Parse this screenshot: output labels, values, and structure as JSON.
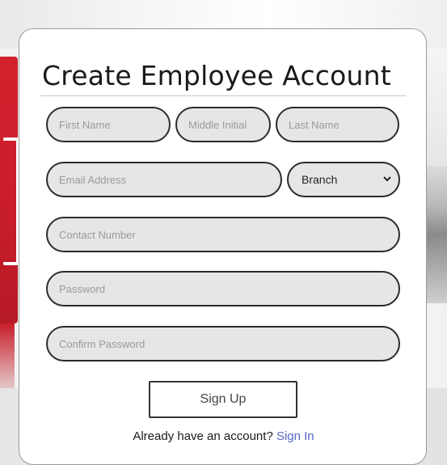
{
  "form": {
    "title": "Create Employee Account",
    "fields": {
      "first_name": "First Name",
      "middle_initial": "Middle Initial",
      "last_name": "Last Name",
      "email": "Email Address",
      "contact": "Contact Number",
      "password": "Password",
      "confirm_password": "Confirm Password"
    },
    "branch_select": {
      "selected": "Branch",
      "icon": "chevron-down-icon"
    },
    "submit_label": "Sign Up",
    "footer_text": "Already have an account?",
    "footer_link": "Sign In"
  },
  "colors": {
    "card_bg": "#ffffff",
    "field_bg": "#e6e6e6",
    "field_border": "#2b2b2b",
    "link": "#5566c7",
    "brand_red": "#d3202d"
  }
}
